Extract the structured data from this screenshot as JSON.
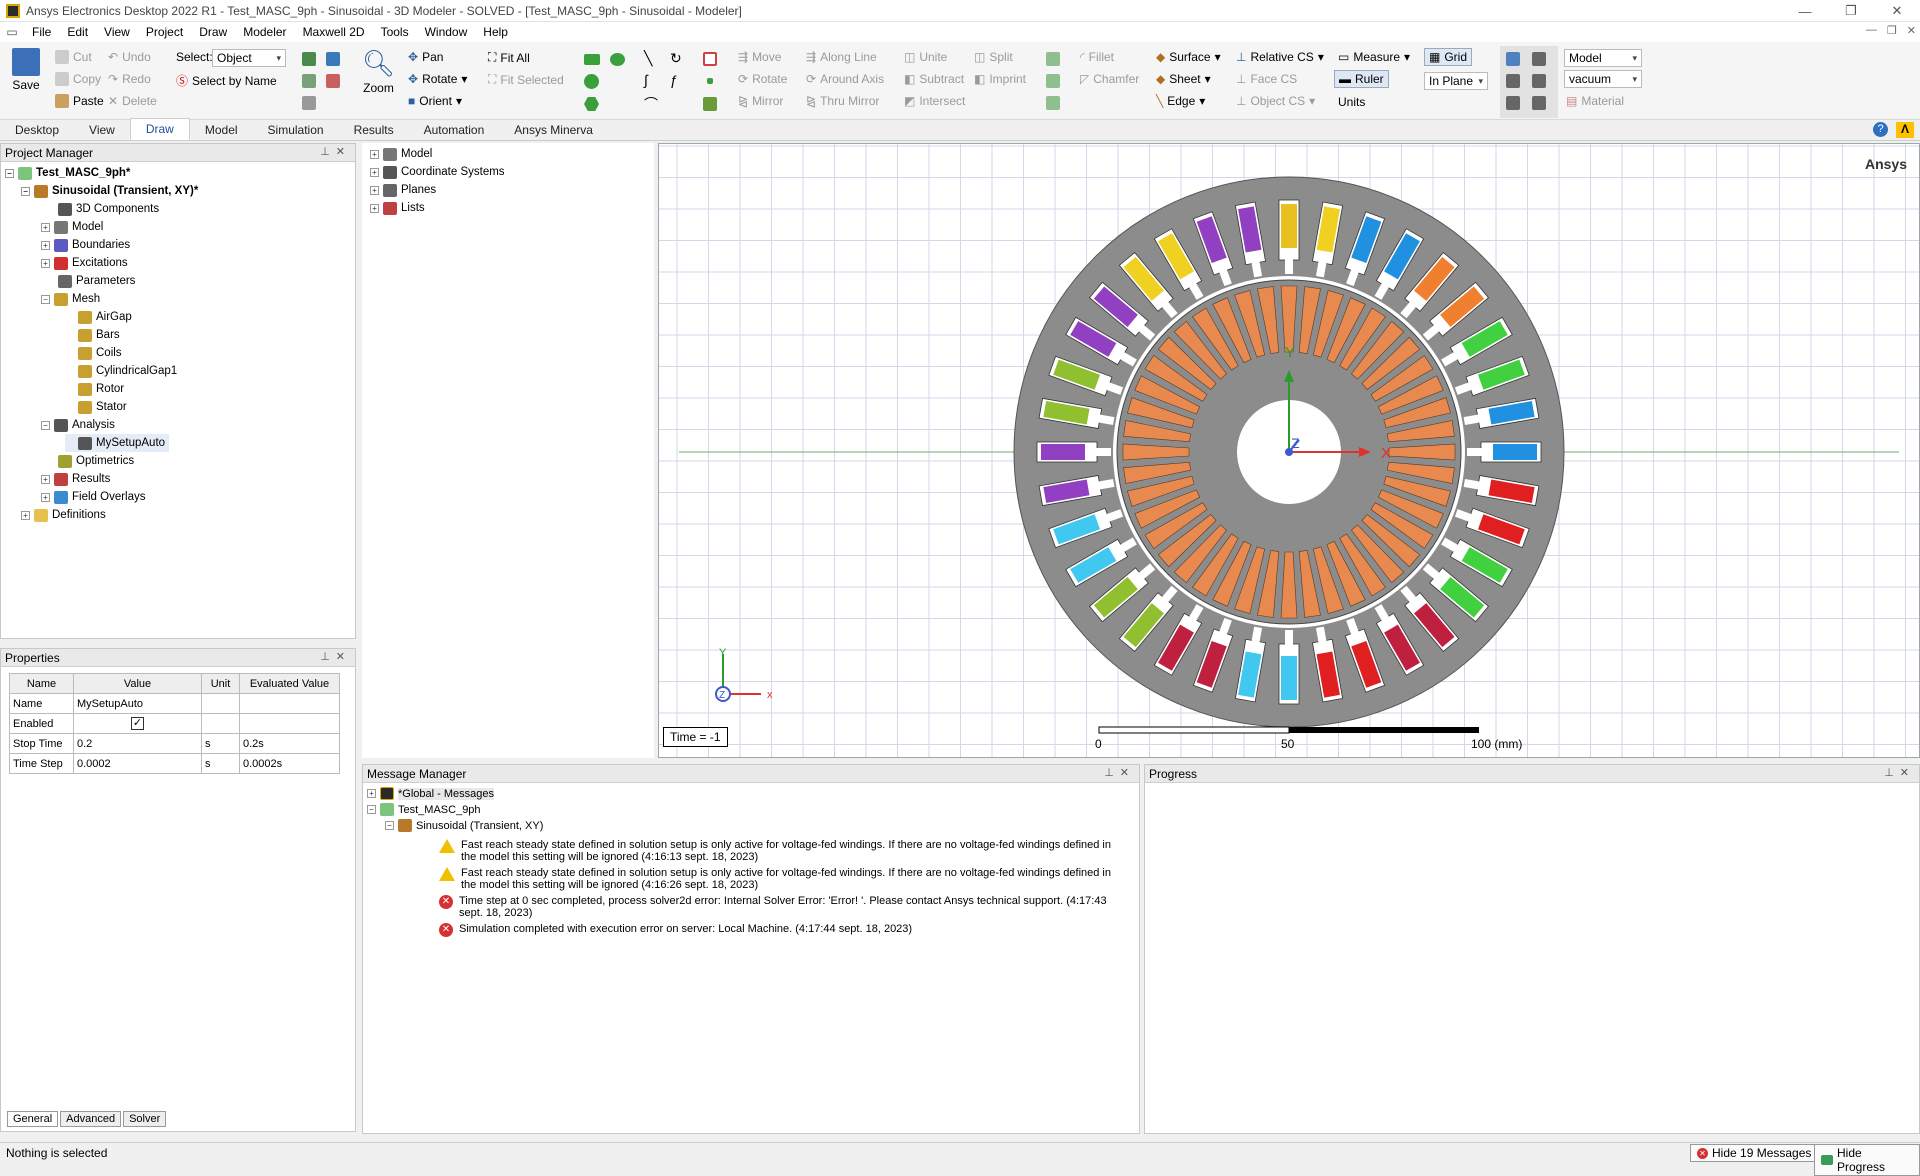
{
  "window": {
    "title": "Ansys Electronics Desktop 2022 R1 - Test_MASC_9ph - Sinusoidal - 3D Modeler - SOLVED - [Test_MASC_9ph - Sinusoidal - Modeler]"
  },
  "menu": [
    "File",
    "Edit",
    "View",
    "Project",
    "Draw",
    "Modeler",
    "Maxwell 2D",
    "Tools",
    "Window",
    "Help"
  ],
  "ribbon": {
    "save": "Save",
    "cut": "Cut",
    "copy": "Copy",
    "paste": "Paste",
    "undo": "Undo",
    "redo": "Redo",
    "delete": "Delete",
    "select_label": "Select:",
    "select_value": "Object",
    "select_by_name": "Select by Name",
    "pan": "Pan",
    "rotate": "Rotate",
    "orient": "Orient",
    "zoom": "Zoom",
    "fit_all": "Fit All",
    "fit_selected": "Fit Selected",
    "move": "Move",
    "rotate2": "Rotate",
    "mirror": "Mirror",
    "along_line": "Along Line",
    "around_axis": "Around Axis",
    "thru_mirror": "Thru Mirror",
    "unite": "Unite",
    "subtract": "Subtract",
    "intersect": "Intersect",
    "split": "Split",
    "imprint": "Imprint",
    "fillet": "Fillet",
    "chamfer": "Chamfer",
    "surface": "Surface",
    "sheet": "Sheet",
    "edge": "Edge",
    "relative_cs": "Relative CS",
    "face_cs": "Face CS",
    "object_cs": "Object CS",
    "measure": "Measure",
    "ruler": "Ruler",
    "units": "Units",
    "grid": "Grid",
    "in_plane": "In Plane",
    "model": "Model",
    "vacuum": "vacuum",
    "material": "Material"
  },
  "tabs": [
    "Desktop",
    "View",
    "Draw",
    "Model",
    "Simulation",
    "Results",
    "Automation",
    "Ansys Minerva"
  ],
  "project_manager": {
    "title": "Project Manager",
    "items": [
      "Test_MASC_9ph*",
      "Sinusoidal (Transient, XY)*",
      "3D Components",
      "Model",
      "Boundaries",
      "Excitations",
      "Parameters",
      "Mesh",
      "AirGap",
      "Bars",
      "Coils",
      "CylindricalGap1",
      "Rotor",
      "Stator",
      "Analysis",
      "MySetupAuto",
      "Optimetrics",
      "Results",
      "Field Overlays",
      "Definitions"
    ]
  },
  "model_tree": [
    "Model",
    "Coordinate Systems",
    "Planes",
    "Lists"
  ],
  "properties": {
    "title": "Properties",
    "headers": [
      "Name",
      "Value",
      "Unit",
      "Evaluated Value"
    ],
    "rows": [
      {
        "name": "Name",
        "value": "MySetupAuto",
        "unit": "",
        "eval": ""
      },
      {
        "name": "Enabled",
        "value": "",
        "unit": "",
        "eval": ""
      },
      {
        "name": "Stop Time",
        "value": "0.2",
        "unit": "s",
        "eval": "0.2s"
      },
      {
        "name": "Time Step",
        "value": "0.0002",
        "unit": "s",
        "eval": "0.0002s"
      }
    ],
    "tabs": [
      "General",
      "Advanced",
      "Solver"
    ]
  },
  "viewport": {
    "brand": "Ansys",
    "time": "Time = -1",
    "scale": [
      "0",
      "50",
      "100 (mm)"
    ],
    "axis": {
      "x": "X",
      "y": "Y",
      "z": "Z",
      "tx": "x",
      "ty": "Y",
      "tz": "Z"
    }
  },
  "messages": {
    "title": "Message Manager",
    "global": "*Global - Messages",
    "project": "Test_MASC_9ph",
    "design": "Sinusoidal (Transient, XY)",
    "items": [
      {
        "type": "warn",
        "text": "Fast reach steady state defined in solution setup is only active for voltage-fed windings. If there are no voltage-fed windings defined in the model this setting will be ignored (4:16:13  sept. 18, 2023)"
      },
      {
        "type": "warn",
        "text": "Fast reach steady state defined in solution setup is only active for voltage-fed windings. If there are no voltage-fed windings defined in the model this setting will be ignored (4:16:26  sept. 18, 2023)"
      },
      {
        "type": "err",
        "text": "Time step at 0 sec completed, process solver2d error: Internal Solver Error:  'Error! '. Please contact Ansys technical support. (4:17:43  sept. 18, 2023)"
      },
      {
        "type": "err",
        "text": "Simulation completed with execution error on server: Local Machine. (4:17:44  sept. 18, 2023)"
      }
    ]
  },
  "progress": {
    "title": "Progress"
  },
  "status": {
    "text": "Nothing is selected",
    "hide_messages": "Hide 19 Messages",
    "hide_progress": "Hide Progress"
  },
  "colors": {
    "stator": "#8c8c8c",
    "rotor_bar": "#e88a50",
    "bg": "#ffffff",
    "grid": "#d6d6e8"
  },
  "slot_colors": [
    "#e8c020",
    "#f0d020",
    "#2090e0",
    "#2090e0",
    "#f08030",
    "#f08030",
    "#40d040",
    "#40d040",
    "#2090e0",
    "#2090e0",
    "#e02020",
    "#e02020",
    "#40d040",
    "#40d040",
    "#c02040",
    "#c02040",
    "#e02020",
    "#e02020",
    "#40c8f0",
    "#40c8f0",
    "#c02040",
    "#c02040",
    "#90c030",
    "#90c030",
    "#40c8f0",
    "#40c8f0",
    "#9040c0",
    "#9040c0",
    "#90c030",
    "#90c030",
    "#9040c0",
    "#9040c0",
    "#f0d020",
    "#f0d020",
    "#9040c0",
    "#9040c0"
  ]
}
